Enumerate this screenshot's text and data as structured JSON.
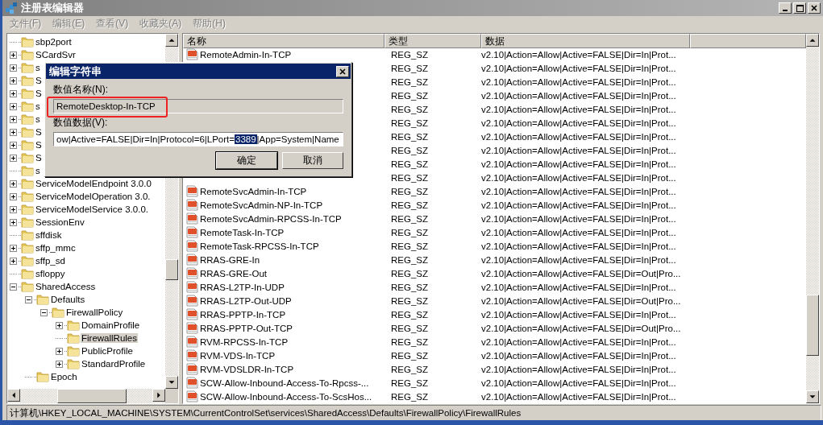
{
  "window": {
    "title": "注册表编辑器"
  },
  "menu": [
    "文件(F)",
    "编辑(E)",
    "查看(V)",
    "收藏夹(A)",
    "帮助(H)"
  ],
  "tree": [
    {
      "label": "sbp2port",
      "selected": false
    },
    {
      "label": "SCardSvr",
      "expanded": false,
      "selected": false
    },
    {
      "label": "s",
      "expanded": false,
      "selected": false
    },
    {
      "label": "S",
      "expanded": false,
      "selected": false
    },
    {
      "label": "S",
      "expanded": false,
      "selected": false
    },
    {
      "label": "s",
      "expanded": false,
      "selected": false
    },
    {
      "label": "s",
      "expanded": false,
      "selected": false
    },
    {
      "label": "S",
      "expanded": false,
      "selected": false
    },
    {
      "label": "S",
      "expanded": false,
      "selected": false
    },
    {
      "label": "S",
      "expanded": false,
      "selected": false
    },
    {
      "label": "s",
      "selected": false
    },
    {
      "label": "ServiceModelEndpoint 3.0.0",
      "expanded": false,
      "selected": false
    },
    {
      "label": "ServiceModelOperation 3.0.",
      "expanded": false,
      "selected": false
    },
    {
      "label": "ServiceModelService 3.0.0.",
      "expanded": false,
      "selected": false
    },
    {
      "label": "SessionEnv",
      "expanded": false,
      "selected": false
    },
    {
      "label": "sffdisk",
      "selected": false
    },
    {
      "label": "sffp_mmc",
      "expanded": false,
      "selected": false
    },
    {
      "label": "sffp_sd",
      "expanded": false,
      "selected": false
    },
    {
      "label": "sfloppy",
      "selected": false
    },
    {
      "label": "SharedAccess",
      "expanded": true,
      "selected": false,
      "children": [
        {
          "label": "Defaults",
          "expanded": true,
          "selected": false,
          "children": [
            {
              "label": "FirewallPolicy",
              "expanded": true,
              "selected": false,
              "children": [
                {
                  "label": "DomainProfile",
                  "expanded": false,
                  "selected": false
                },
                {
                  "label": "FirewallRules",
                  "selected": true
                },
                {
                  "label": "PublicProfile",
                  "expanded": false,
                  "selected": false
                },
                {
                  "label": "StandardProfile",
                  "expanded": false,
                  "selected": false
                }
              ]
            }
          ]
        },
        {
          "label": "Epoch",
          "selected": false
        }
      ]
    }
  ],
  "list": {
    "columns": [
      "名称",
      "类型",
      "数据"
    ],
    "rows": [
      {
        "name": "RemoteAdmin-In-TCP",
        "type": "REG_SZ",
        "data": "v2.10|Action=Allow|Active=FALSE|Dir=In|Prot..."
      },
      {
        "type": "REG_SZ",
        "data": "v2.10|Action=Allow|Active=FALSE|Dir=In|Prot..."
      },
      {
        "type": "REG_SZ",
        "data": "v2.10|Action=Allow|Active=FALSE|Dir=In|Prot..."
      },
      {
        "type": "REG_SZ",
        "data": "v2.10|Action=Allow|Active=FALSE|Dir=In|Prot..."
      },
      {
        "type": "REG_SZ",
        "data": "v2.10|Action=Allow|Active=FALSE|Dir=In|Prot..."
      },
      {
        "type": "REG_SZ",
        "data": "v2.10|Action=Allow|Active=FALSE|Dir=In|Prot..."
      },
      {
        "type": "REG_SZ",
        "data": "v2.10|Action=Allow|Active=FALSE|Dir=In|Prot..."
      },
      {
        "type": "REG_SZ",
        "data": "v2.10|Action=Allow|Active=FALSE|Dir=In|Prot..."
      },
      {
        "type": "REG_SZ",
        "data": "v2.10|Action=Allow|Active=FALSE|Dir=In|Prot..."
      },
      {
        "type": "REG_SZ",
        "data": "v2.10|Action=Allow|Active=FALSE|Dir=In|Prot..."
      },
      {
        "name": "RemoteSvcAdmin-In-TCP",
        "type": "REG_SZ",
        "data": "v2.10|Action=Allow|Active=FALSE|Dir=In|Prot..."
      },
      {
        "name": "RemoteSvcAdmin-NP-In-TCP",
        "type": "REG_SZ",
        "data": "v2.10|Action=Allow|Active=FALSE|Dir=In|Prot..."
      },
      {
        "name": "RemoteSvcAdmin-RPCSS-In-TCP",
        "type": "REG_SZ",
        "data": "v2.10|Action=Allow|Active=FALSE|Dir=In|Prot..."
      },
      {
        "name": "RemoteTask-In-TCP",
        "type": "REG_SZ",
        "data": "v2.10|Action=Allow|Active=FALSE|Dir=In|Prot..."
      },
      {
        "name": "RemoteTask-RPCSS-In-TCP",
        "type": "REG_SZ",
        "data": "v2.10|Action=Allow|Active=FALSE|Dir=In|Prot..."
      },
      {
        "name": "RRAS-GRE-In",
        "type": "REG_SZ",
        "data": "v2.10|Action=Allow|Active=FALSE|Dir=In|Prot..."
      },
      {
        "name": "RRAS-GRE-Out",
        "type": "REG_SZ",
        "data": "v2.10|Action=Allow|Active=FALSE|Dir=Out|Pro..."
      },
      {
        "name": "RRAS-L2TP-In-UDP",
        "type": "REG_SZ",
        "data": "v2.10|Action=Allow|Active=FALSE|Dir=In|Prot..."
      },
      {
        "name": "RRAS-L2TP-Out-UDP",
        "type": "REG_SZ",
        "data": "v2.10|Action=Allow|Active=FALSE|Dir=Out|Pro..."
      },
      {
        "name": "RRAS-PPTP-In-TCP",
        "type": "REG_SZ",
        "data": "v2.10|Action=Allow|Active=FALSE|Dir=In|Prot..."
      },
      {
        "name": "RRAS-PPTP-Out-TCP",
        "type": "REG_SZ",
        "data": "v2.10|Action=Allow|Active=FALSE|Dir=Out|Pro..."
      },
      {
        "name": "RVM-RPCSS-In-TCP",
        "type": "REG_SZ",
        "data": "v2.10|Action=Allow|Active=FALSE|Dir=In|Prot..."
      },
      {
        "name": "RVM-VDS-In-TCP",
        "type": "REG_SZ",
        "data": "v2.10|Action=Allow|Active=FALSE|Dir=In|Prot..."
      },
      {
        "name": "RVM-VDSLDR-In-TCP",
        "type": "REG_SZ",
        "data": "v2.10|Action=Allow|Active=FALSE|Dir=In|Prot..."
      },
      {
        "name": "SCW-Allow-Inbound-Access-To-Rpcss-...",
        "type": "REG_SZ",
        "data": "v2.10|Action=Allow|Active=FALSE|Dir=In|Prot..."
      },
      {
        "name": "SCW-Allow-Inbound-Access-To-ScsHos...",
        "type": "REG_SZ",
        "data": "v2.10|Action=Allow|Active=FALSE|Dir=In|Prot..."
      }
    ]
  },
  "dialog": {
    "title": "编辑字符串",
    "name_label": "数值名称(N):",
    "name_value": "RemoteDesktop-In-TCP",
    "data_label": "数值数据(V):",
    "data_value_before": "ow|Active=FALSE|Dir=In|Protocol=6|LPort=",
    "data_value_selected": "3389",
    "data_value_after": "|App=System|Name",
    "buttons": [
      "确定",
      "取消"
    ]
  },
  "status_bar": "计算机\\HKEY_LOCAL_MACHINE\\SYSTEM\\CurrentControlSet\\services\\SharedAccess\\Defaults\\FirewallPolicy\\FirewallRules"
}
